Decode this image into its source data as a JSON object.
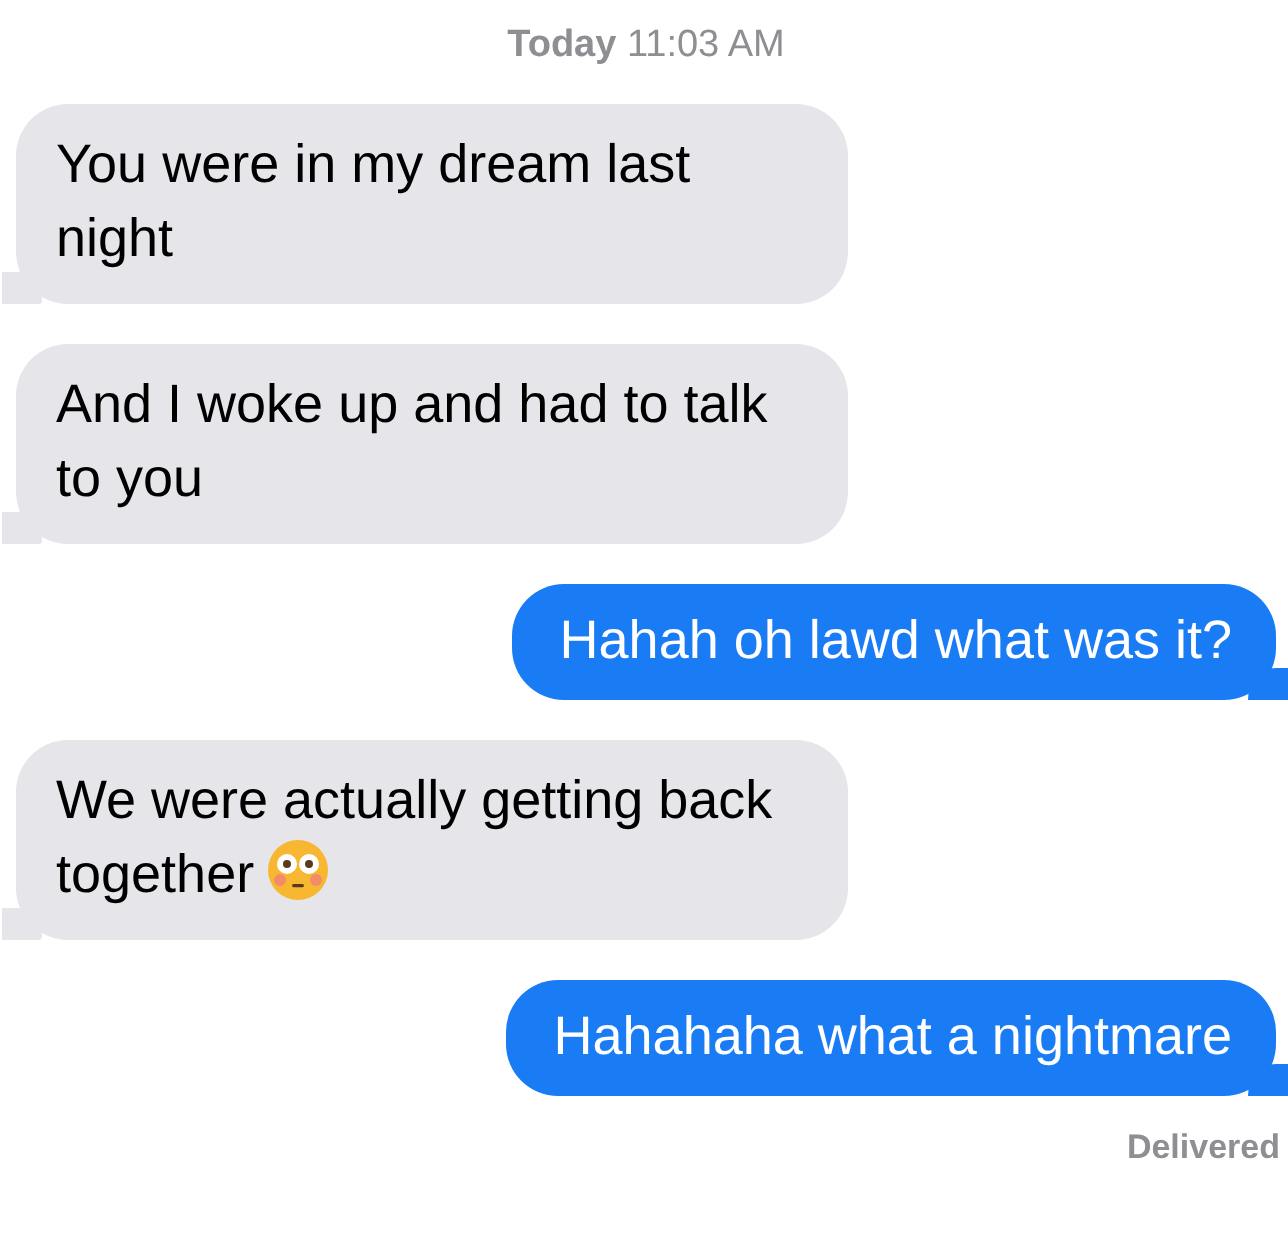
{
  "timestamp": "**Today** 11:03 AM",
  "messages": [
    {
      "kind": "received",
      "text": "You were in my dream last night"
    },
    {
      "kind": "received",
      "text": "And I woke up and had to talk to you"
    },
    {
      "kind": "sent",
      "text": "Hahah oh lawd what was it?"
    },
    {
      "kind": "received",
      "text": "We were actually getting back together",
      "trailing_icon": true
    },
    {
      "kind": "sent",
      "text": "Hahahaha what a nightmare"
    }
  ],
  "status": "Delivered"
}
